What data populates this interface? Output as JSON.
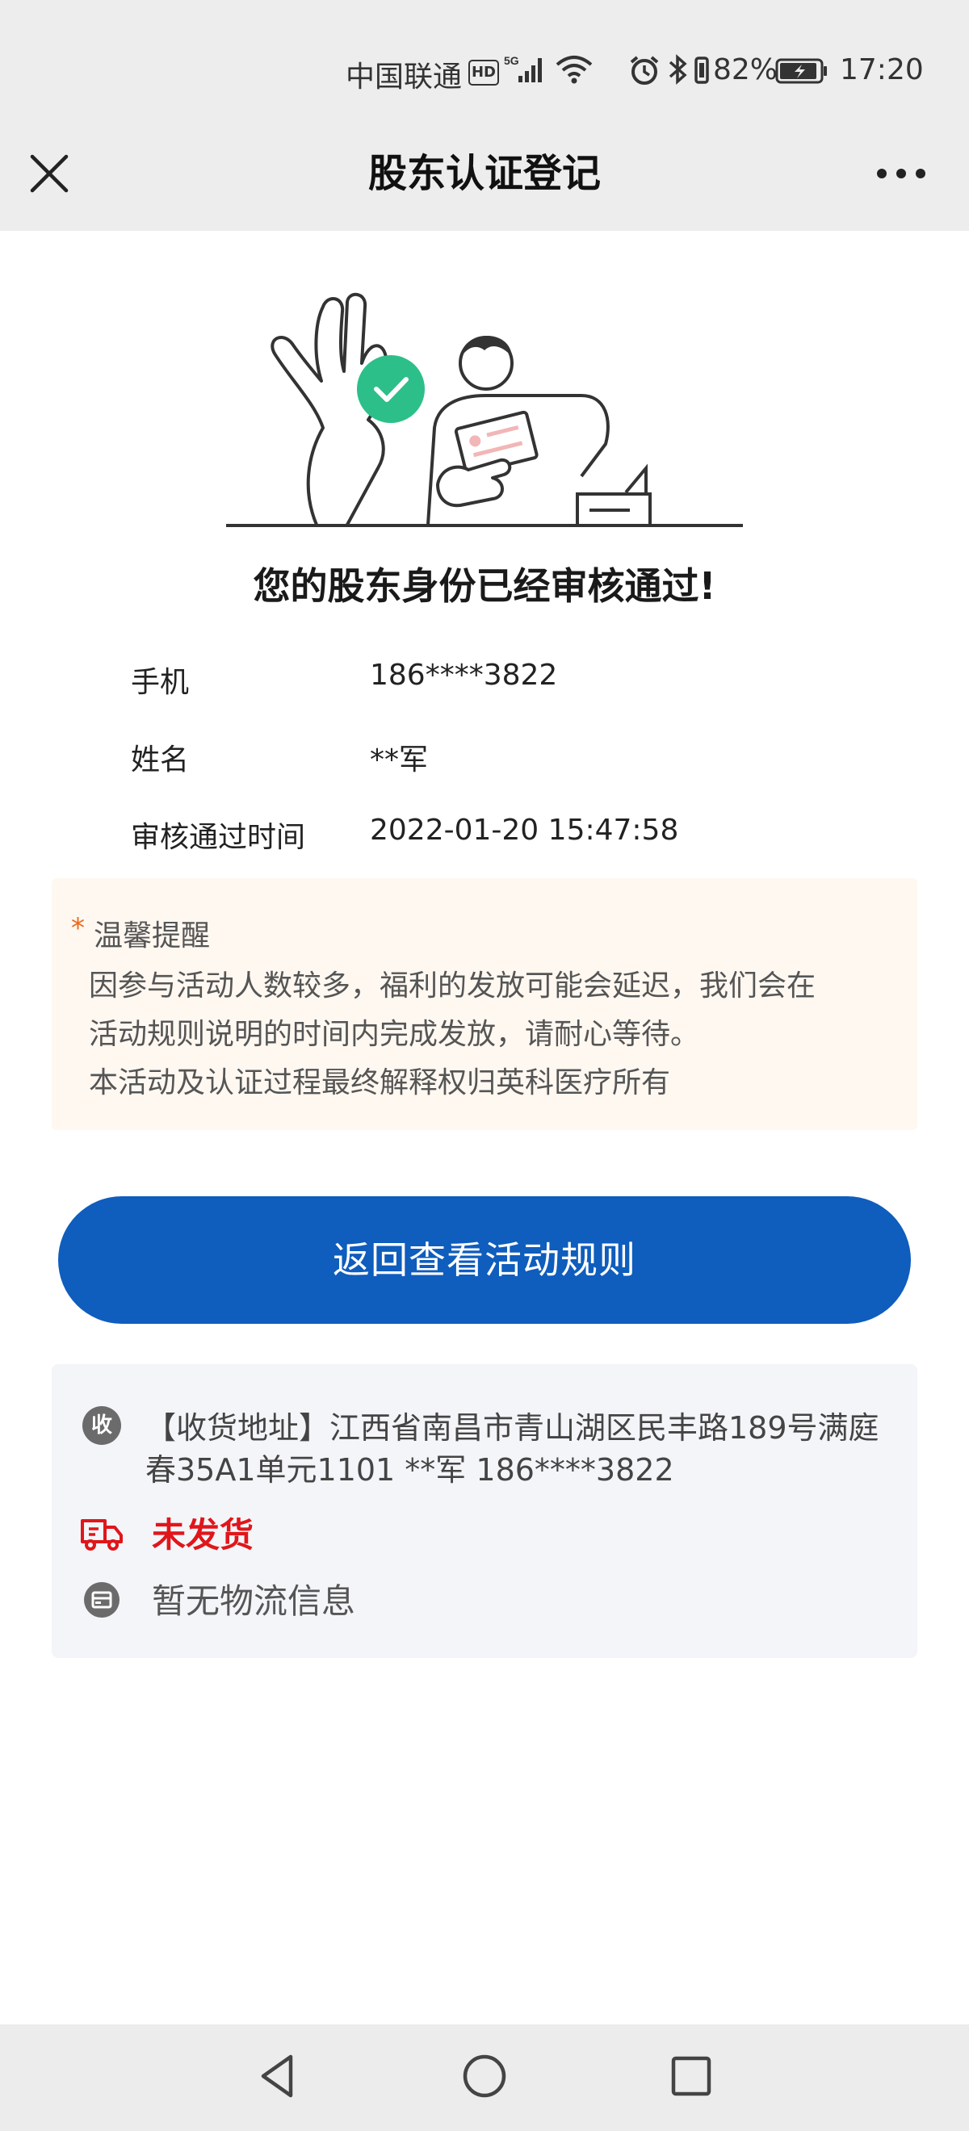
{
  "status_bar": {
    "carrier": "中国联通",
    "hd_badge": "HD",
    "network": "5G",
    "battery_percent": "82%",
    "time": "17:20"
  },
  "title_bar": {
    "title": "股东认证登记",
    "close_icon": "close-icon",
    "more_icon": "more-icon"
  },
  "result": {
    "message": "您的股东身份已经审核通过!"
  },
  "info": [
    {
      "label": "手机",
      "value": "186****3822"
    },
    {
      "label": "姓名",
      "value": "**军"
    },
    {
      "label": "审核通过时间",
      "value": "2022-01-20 15:47:58"
    }
  ],
  "tip": {
    "star": "*",
    "title": "温馨提醒",
    "lines": [
      "因参与活动人数较多，福利的发放可能会延迟，我们会在",
      "活动规则说明的时间内完成发放，请耐心等待。",
      "本活动及认证过程最终解释权归英科医疗所有"
    ]
  },
  "button": {
    "label": "返回查看活动规则"
  },
  "shipping": {
    "receive_badge": "收",
    "address_lines": [
      "【收货地址】江西省南昌市青山湖区民丰路189号满庭",
      "春35A1单元1101 **军 186****3822"
    ],
    "status": "未发货",
    "logistics": "暂无物流信息"
  },
  "colors": {
    "primary_button": "#0f5dbd",
    "status_red": "#e0161b",
    "check_green": "#2dbf8a",
    "tip_background": "#fff8f1",
    "card_background": "#f3f5f8"
  }
}
